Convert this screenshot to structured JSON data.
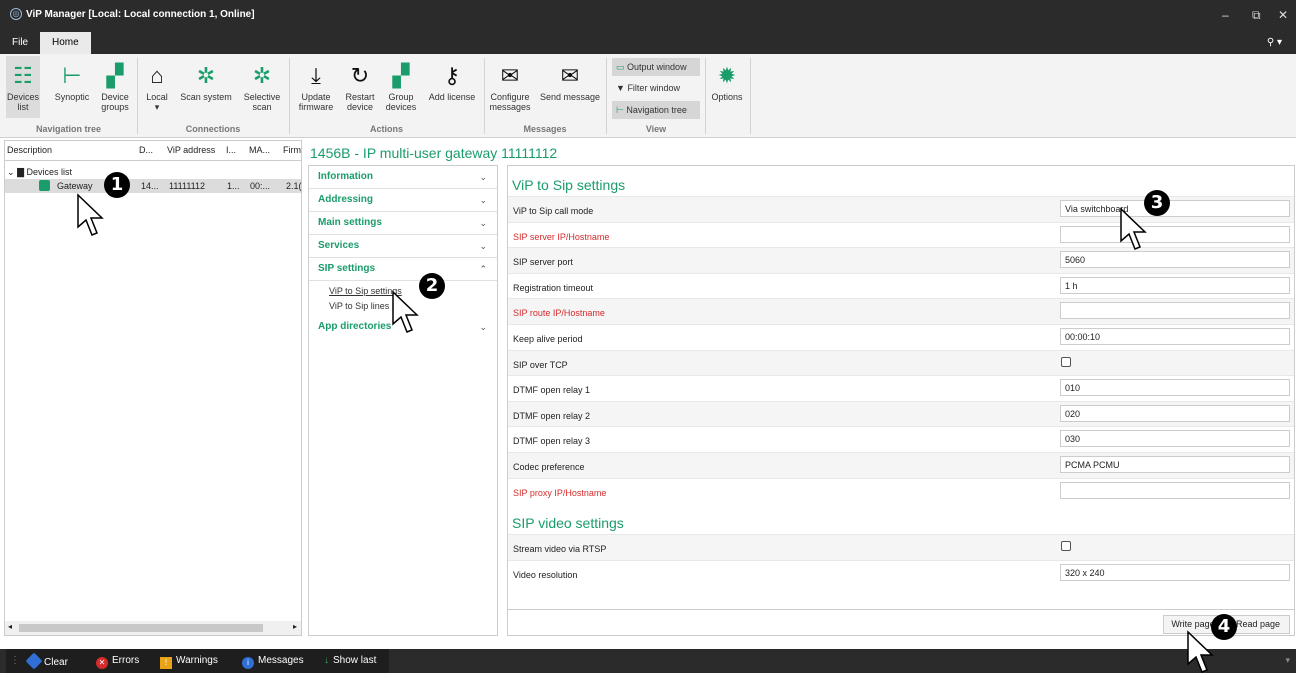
{
  "app_title": "ViP Manager [Local: Local connection 1, Online]",
  "window_controls": {
    "minimize": "–",
    "maximize": "⧉",
    "close": "✕"
  },
  "menu": {
    "file": "File",
    "home": "Home",
    "user": "⚲ ▾"
  },
  "ribbon": {
    "devices_list": "Devices\nlist",
    "synoptic": "Synoptic",
    "device_groups": "Device\ngroups",
    "local": "Local\n▾",
    "scan_system": "Scan system",
    "selective_scan": "Selective\nscan",
    "update_firmware": "Update\nfirmware",
    "restart_device": "Restart\ndevice",
    "group_devices": "Group\ndevices",
    "add_license": "Add license",
    "configure_messages": "Configure\nmessages",
    "send_message": "Send message",
    "output_window": "Output window",
    "filter_window": "Filter window",
    "navigation_tree": "Navigation tree",
    "options": "Options",
    "groups": {
      "navigation_tree": "Navigation tree",
      "connections": "Connections",
      "actions": "Actions",
      "messages": "Messages",
      "view": "View"
    }
  },
  "tree": {
    "headers": [
      "Description",
      "D...",
      "ViP address",
      "I...",
      "MA...",
      "Firm"
    ],
    "root": "Devices list",
    "device": {
      "name": "Gateway",
      "d": "14...",
      "vip_address": "11111112",
      "i": "1...",
      "mac": "00:...",
      "firm": "2.1("
    }
  },
  "main_title": "1456B - IP multi-user gateway 11111112",
  "accordion": {
    "information": "Information",
    "addressing": "Addressing",
    "main_settings": "Main settings",
    "services": "Services",
    "sip_settings": "SIP settings",
    "sip_sub": [
      "ViP to Sip settings",
      "ViP to Sip lines"
    ],
    "app_directories": "App directories"
  },
  "vip_to_sip": {
    "title": "ViP to Sip settings",
    "rows": [
      {
        "label": "ViP to Sip call mode",
        "value": "Via switchboard",
        "red": false
      },
      {
        "label": "SIP server IP/Hostname",
        "value": "",
        "red": true
      },
      {
        "label": "SIP server port",
        "value": "5060",
        "red": false
      },
      {
        "label": "Registration timeout",
        "value": "1 h",
        "red": false
      },
      {
        "label": "SIP route IP/Hostname",
        "value": "",
        "red": true
      },
      {
        "label": "Keep alive period",
        "value": "00:00:10",
        "red": false
      },
      {
        "label": "SIP over TCP",
        "checkbox": false,
        "red": false
      },
      {
        "label": "DTMF open relay 1",
        "value": "010",
        "red": false
      },
      {
        "label": "DTMF open relay 2",
        "value": "020",
        "red": false
      },
      {
        "label": "DTMF open relay 3",
        "value": "030",
        "red": false
      },
      {
        "label": "Codec preference",
        "value": "PCMA PCMU",
        "red": false
      },
      {
        "label": "SIP proxy IP/Hostname",
        "value": "",
        "red": true
      }
    ]
  },
  "sip_video": {
    "title": "SIP video settings",
    "rows": [
      {
        "label": "Stream video via RTSP",
        "checkbox": false
      },
      {
        "label": "Video resolution",
        "value": "320 x 240"
      }
    ]
  },
  "buttons": {
    "write_page": "Write page",
    "read_page": "Read page"
  },
  "status": {
    "clear": "Clear",
    "errors": "Errors",
    "warnings": "Warnings",
    "messages": "Messages",
    "show_last": "Show last"
  },
  "callouts": [
    "1",
    "2",
    "3",
    "4"
  ],
  "colors": {
    "accent_green": "#1a9d6a",
    "required_red": "#d42b2b",
    "dark_chrome": "#2b2b2b"
  }
}
